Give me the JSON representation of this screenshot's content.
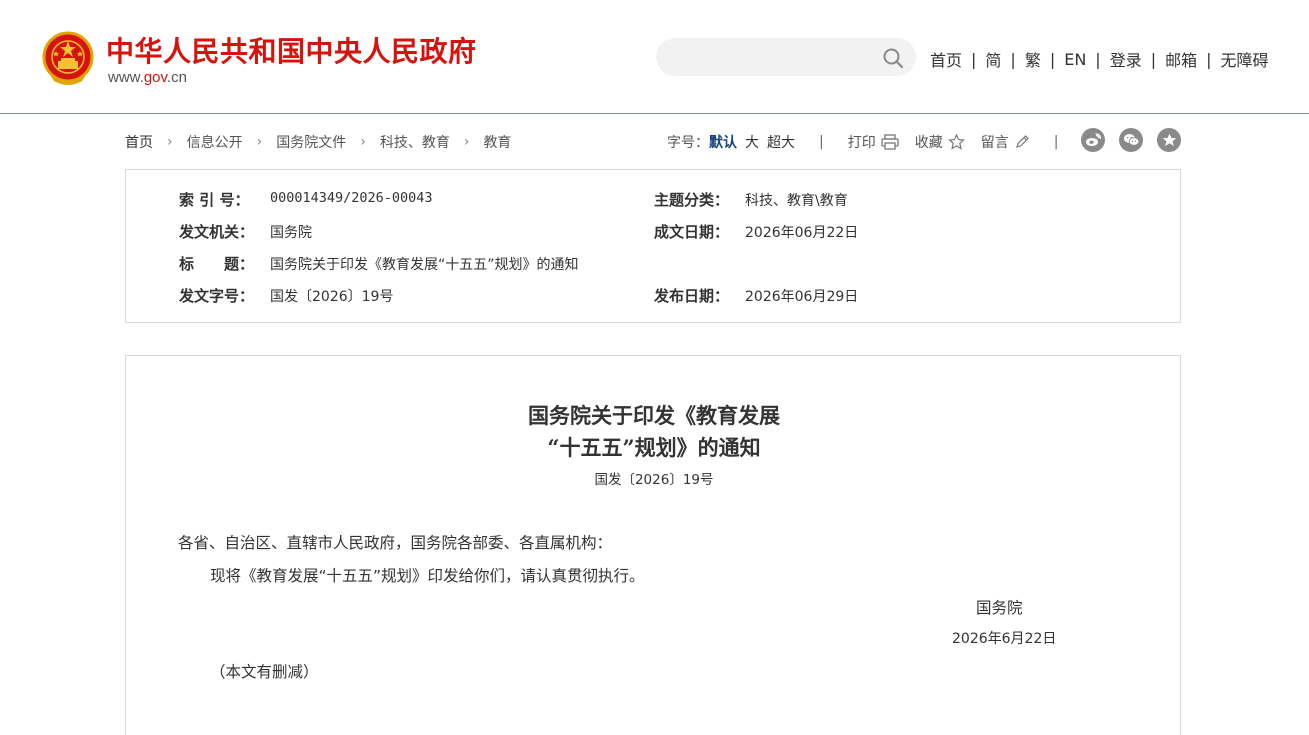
{
  "header": {
    "site_title": "中华人民共和国中央人民政府",
    "domain_prefix": "www.",
    "domain_main": "gov",
    "domain_suffix": ".cn",
    "search_placeholder": "",
    "nav": [
      "首页",
      "简",
      "繁",
      "EN",
      "登录",
      "邮箱",
      "无障碍"
    ],
    "nav_separator": "|"
  },
  "breadcrumb": {
    "items": [
      "首页",
      "信息公开",
      "国务院文件",
      "科技、教育",
      "教育"
    ],
    "chevron": "›"
  },
  "tools": {
    "font_size_label": "字号：",
    "font_sizes": [
      "默认",
      "大",
      "超大"
    ],
    "separator": "|",
    "print_label": "打印",
    "favorite_label": "收藏",
    "comment_label": "留言",
    "share_icons": [
      "weibo-icon",
      "wechat-icon",
      "qzone-star-icon"
    ]
  },
  "info": {
    "index_key": "索 引 号：",
    "index_val": "000014349/2026-00043",
    "topic_key": "主题分类：",
    "topic_val": "科技、教育\\教育",
    "issuer_key": "发文机关：",
    "issuer_val": "国务院",
    "created_key": "成文日期：",
    "created_val": "2026年06月22日",
    "title_key": "标　　题：",
    "title_val": "国务院关于印发《教育发展“十五五”规划》的通知",
    "docno_key": "发文字号：",
    "docno_val": "国发〔2026〕19号",
    "published_key": "发布日期：",
    "published_val": "2026年06月29日"
  },
  "article": {
    "title_line1": "国务院关于印发《教育发展",
    "title_line2": "“十五五”规划》的通知",
    "doc_number": "国发〔2026〕19号",
    "salutation": "各省、自治区、直辖市人民政府，国务院各部委、各直属机构：",
    "body": "现将《教育发展“十五五”规划》印发给你们，请认真贯彻执行。",
    "signature": "国务院",
    "date": "2026年6月22日",
    "note": "（本文有删减）"
  },
  "colors": {
    "brand_red": "#d7130e",
    "accent_blue": "#18427b",
    "header_rule": "#7a95b1",
    "icon_gray": "#8a8a8a"
  }
}
